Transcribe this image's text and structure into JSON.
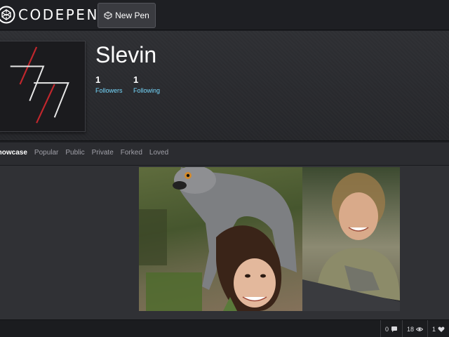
{
  "header": {
    "logo_text": "CODEPEN",
    "new_pen_label": "New Pen"
  },
  "profile": {
    "name": "Slevin",
    "followers": {
      "count": "1",
      "label": "Followers"
    },
    "following": {
      "count": "1",
      "label": "Following"
    }
  },
  "tabs": [
    {
      "label": "Showcase",
      "active": true
    },
    {
      "label": "Popular",
      "active": false
    },
    {
      "label": "Public",
      "active": false
    },
    {
      "label": "Private",
      "active": false
    },
    {
      "label": "Forked",
      "active": false
    },
    {
      "label": "Loved",
      "active": false
    }
  ],
  "stats": {
    "comments": "0",
    "views": "18",
    "likes": "1"
  },
  "colors": {
    "accent_link": "#76daff",
    "avatar_red": "#c1272d",
    "avatar_white": "#e8e8e8"
  },
  "icons": [
    "codepen-logo-icon",
    "codepen-small-icon",
    "comment-icon",
    "eye-icon",
    "heart-icon"
  ]
}
